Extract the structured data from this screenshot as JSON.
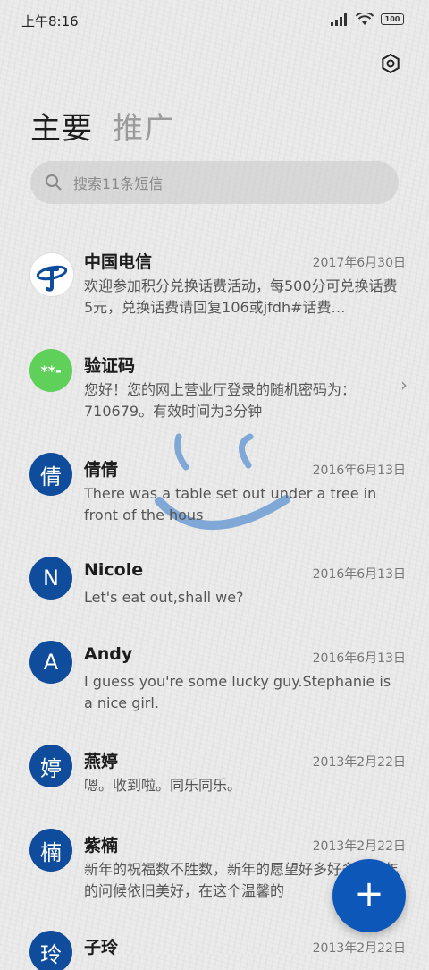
{
  "status": {
    "time": "上午8:16",
    "battery": "100"
  },
  "tabs": [
    {
      "label": "主要"
    },
    {
      "label": "推广"
    }
  ],
  "search": {
    "placeholder": "搜索11条短信"
  },
  "messages": [
    {
      "avatar": "",
      "name": "中国电信",
      "date": "2017年6月30日",
      "preview": "欢迎参加积分兑换话费活动，每500分可兑换话费5元，兑换话费请回复106或jfdh#话费…"
    },
    {
      "avatar": "**-",
      "name": "验证码",
      "date": "",
      "preview": "您好！您的网上营业厅登录的随机密码为：710679。有效时间为3分钟"
    },
    {
      "avatar": "倩",
      "name": "倩倩",
      "date": "2016年6月13日",
      "preview": "There was a table set out under a tree in front of the hous"
    },
    {
      "avatar": "N",
      "name": "Nicole",
      "date": "2016年6月13日",
      "preview": "Let's eat out,shall we?"
    },
    {
      "avatar": "A",
      "name": "Andy",
      "date": "2016年6月13日",
      "preview": "I guess you're some lucky guy.Stephanie is a nice girl."
    },
    {
      "avatar": "婷",
      "name": "燕婷",
      "date": "2013年2月22日",
      "preview": "嗯。收到啦。同乐同乐。"
    },
    {
      "avatar": "楠",
      "name": "紫楠",
      "date": "2013年2月22日",
      "preview": "新年的祝福数不胜数，新年的愿望好多好多，新年的问候依旧美好，在这个温馨的"
    },
    {
      "avatar": "玲",
      "name": "子玲",
      "date": "2013年2月22日",
      "preview": ""
    }
  ],
  "colors": {
    "accent": "#0d57b8",
    "avatar_blue": "#0f4d9c",
    "code_green": "#5fd15b"
  }
}
